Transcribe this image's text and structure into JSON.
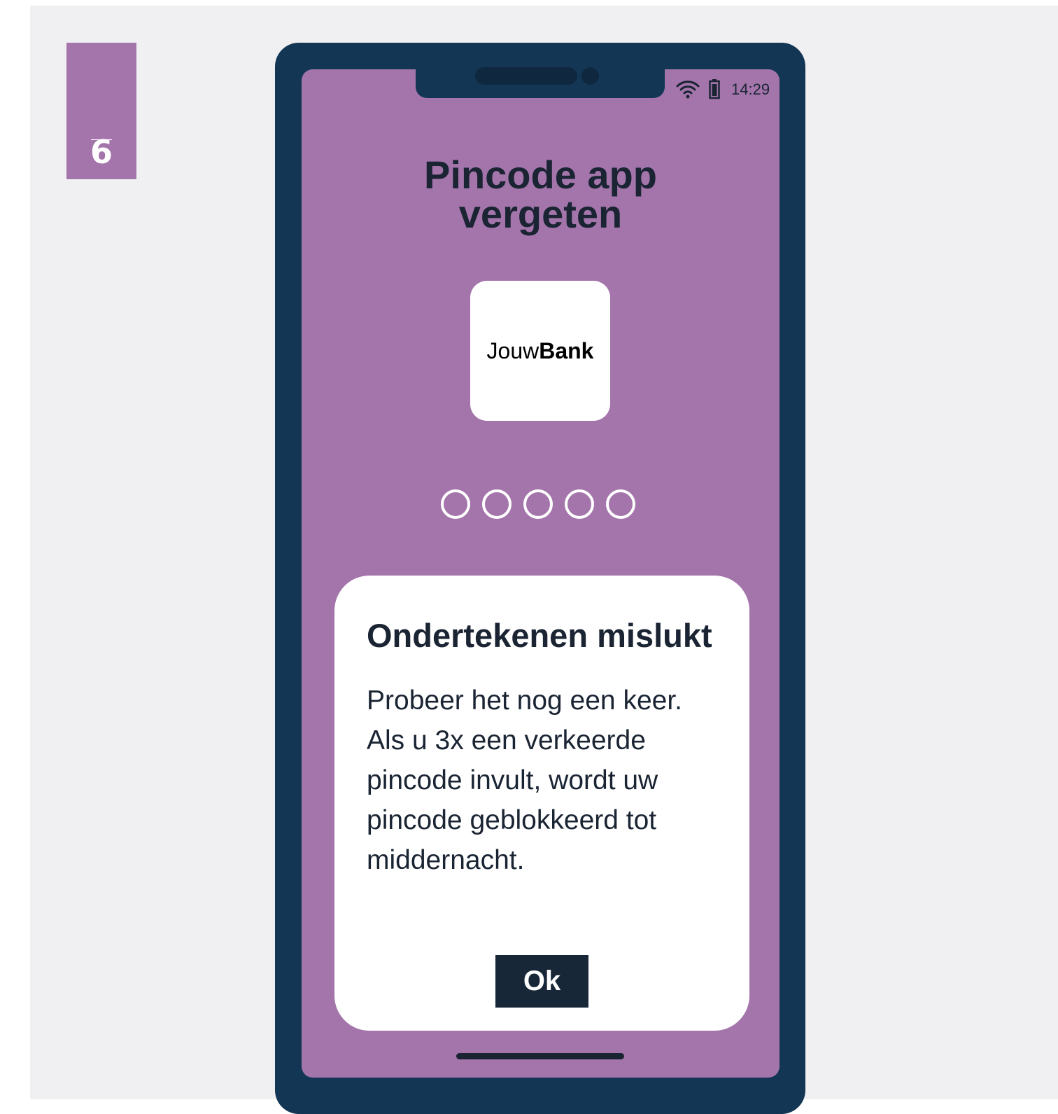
{
  "step": {
    "number": "6"
  },
  "status_bar": {
    "time": "14:29",
    "icons": [
      "wifi-icon",
      "battery-icon"
    ]
  },
  "screen": {
    "title_line1": "Pincode app",
    "title_line2": "vergeten",
    "logo": {
      "part1": "Jouw",
      "part2": "Bank"
    },
    "pin": {
      "length": 5,
      "filled": 0
    }
  },
  "dialog": {
    "title": "Ondertekenen mislukt",
    "body_lines": [
      "Probeer het nog een keer.",
      "Als u 3x een verkeerde",
      "pincode invult, wordt uw",
      "pincode geblokkeerd tot",
      "middernacht."
    ],
    "ok_label": "Ok"
  },
  "colors": {
    "accent": "#a475ab",
    "phone_frame": "#143655",
    "text_dark": "#1a2433",
    "background": "#f0f0f2"
  }
}
